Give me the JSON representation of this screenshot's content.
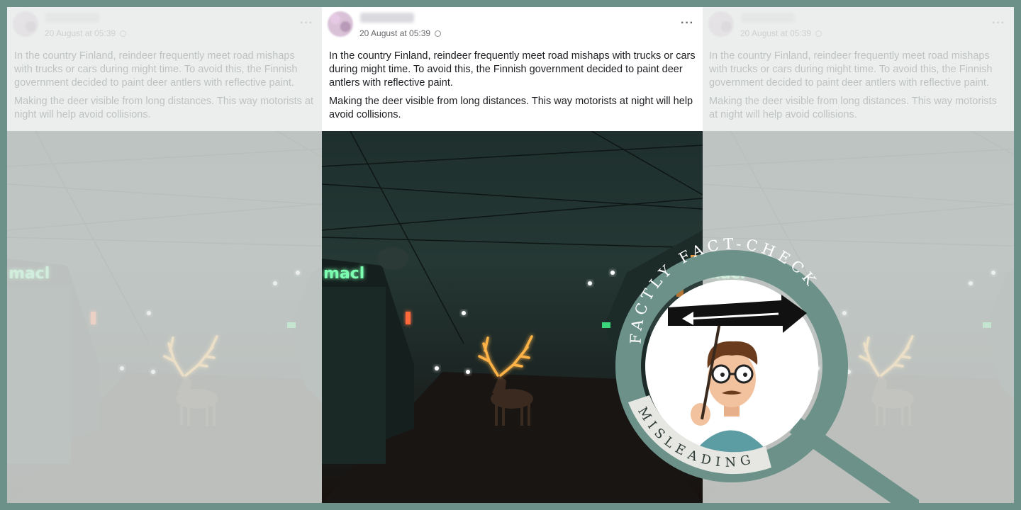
{
  "posts": [
    {
      "variant": "faded-left",
      "date": "20 August at 05:39",
      "paragraphs": [
        "In the country Finland, reindeer frequently meet road mishaps with trucks or cars during might time. To avoid this, the Finnish government decided to paint deer antlers with reflective paint.",
        "Making the deer visible from long distances. This way motorists at night will help avoid collisions."
      ]
    },
    {
      "variant": "center",
      "date": "20 August at 05:39",
      "paragraphs": [
        "In the country Finland, reindeer frequently meet road mishaps with trucks or cars during might time. To avoid this, the Finnish government decided to paint deer antlers with reflective paint.",
        "Making the deer visible from long distances. This way motorists at night will help avoid collisions."
      ]
    },
    {
      "variant": "faded-right",
      "date": "20 August at 05:39",
      "paragraphs": [
        "In the country Finland, reindeer frequently meet road mishaps with trucks or cars during might time. To avoid this, the Finnish government decided to paint deer antlers with reflective paint.",
        "Making the deer visible from long distances. This way motorists at night will help avoid collisions."
      ]
    }
  ],
  "photo": {
    "sign_text": "macl"
  },
  "badge": {
    "arc_text": "FACTLY FACT-CHECK",
    "verdict": "MISLEADING",
    "ring_color": "#6b9188",
    "verdict_band_color": "#e6e7e2"
  },
  "icons": [
    "more-options-icon",
    "globe-icon",
    "magnifier-icon",
    "arrow-icon"
  ],
  "colors": {
    "border": "#6b9188",
    "antler_glow": "#ffb347"
  }
}
